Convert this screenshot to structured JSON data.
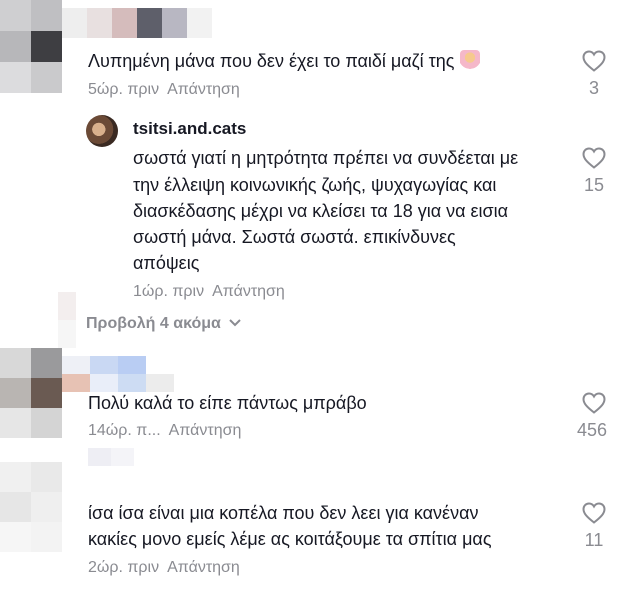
{
  "comments": [
    {
      "text": "Λυπημένη μάνα που δεν έχει το παιδί μαζί της",
      "emoji": "woman-shrugging-emoji",
      "time": "5ώρ. πριν",
      "reply_label": "Απάντηση",
      "likes": "3"
    },
    {
      "username": "tsitsi.and.cats",
      "lines": [
        "σωστά γιατί η μητρότητα πρέπει να συνδέεται με",
        "την έλλειψη κοινωνικής ζωής, ψυχαγωγίας και",
        "διασκέδασης μέχρι να κλείσει τα 18 για να εισια",
        "σωστή μάνα. Σωστά σωστά. επικίνδυνες",
        "απόψεις"
      ],
      "time": "1ώρ. πριν",
      "reply_label": "Απάντηση",
      "likes": "15"
    },
    {
      "text": "Πολύ καλά το είπε πάντως μπράβο",
      "time": "14ώρ. π...",
      "reply_label": "Απάντηση",
      "likes": "456"
    },
    {
      "lines": [
        "ίσα ίσα είναι μια κοπέλα που δεν λεει για κανέναν",
        "κακίες μονο εμείς λέμε ας κοιτάξουμε τα σπίτια μας"
      ],
      "time": "2ώρ. πριν",
      "reply_label": "Απάντηση",
      "likes": "11"
    }
  ],
  "view_more_label": "Προβολή 4 ακόμα",
  "colors": {
    "text": "#161823",
    "muted": "#8a8b91"
  }
}
